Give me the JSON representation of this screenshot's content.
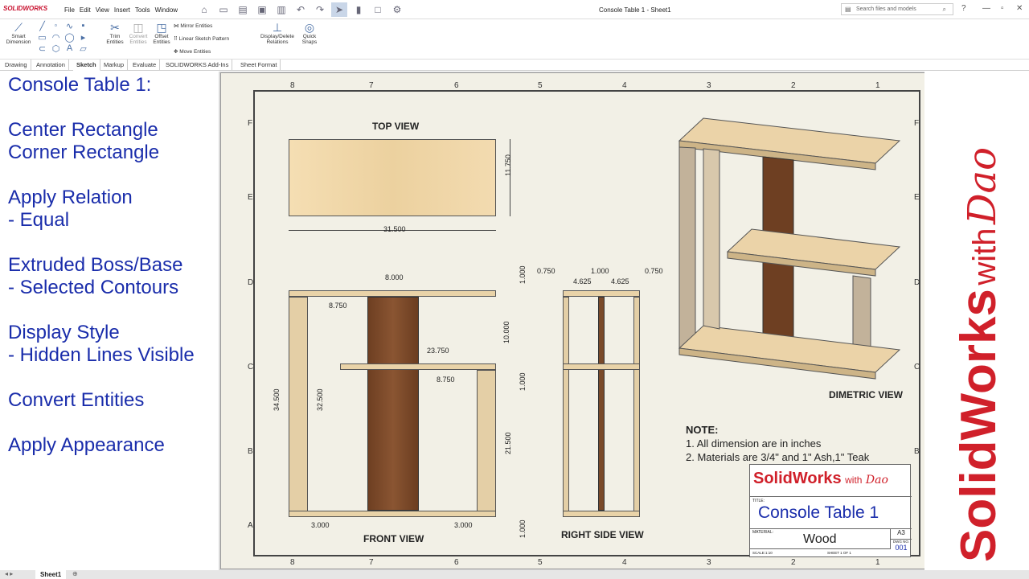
{
  "window": {
    "title": "Console Table 1 - Sheet1",
    "app": "SOLIDWORKS"
  },
  "menu": [
    "File",
    "Edit",
    "View",
    "Insert",
    "Tools",
    "Window"
  ],
  "search": {
    "placeholder": "Search files and models"
  },
  "ribbon": {
    "smart_dimension": "Smart Dimension",
    "trim": "Trim Entities",
    "convert": "Convert Entities",
    "offset": "Offset Entities",
    "mirror": "Mirror Entities",
    "linear_pattern": "Linear Sketch Pattern",
    "move": "Move Entities",
    "display_relations": "Display/Delete Relations",
    "quick_snaps": "Quick Snaps"
  },
  "tabs": [
    "Drawing",
    "Annotation",
    "Sketch",
    "Markup",
    "Evaluate",
    "SOLIDWORKS Add-Ins",
    "Sheet Format"
  ],
  "active_tab": "Sketch",
  "left_panel": {
    "l1": "Console Table 1:",
    "l2": "Center Rectangle",
    "l3": "Corner Rectangle",
    "l4": "Apply Relation",
    "l5": "- Equal",
    "l6": "Extruded Boss/Base",
    "l7": "- Selected Contours",
    "l8": "Display Style",
    "l9": "- Hidden Lines Visible",
    "l10": "Convert Entities",
    "l11": "Apply Appearance"
  },
  "drawing": {
    "zones_cols": [
      "8",
      "7",
      "6",
      "5",
      "4",
      "3",
      "2",
      "1"
    ],
    "zones_rows": [
      "F",
      "E",
      "D",
      "C",
      "B",
      "A"
    ],
    "top_view": "TOP VIEW",
    "front_view": "FRONT VIEW",
    "right_view": "RIGHT SIDE VIEW",
    "dimetric_view": "DIMETRIC VIEW",
    "dims": {
      "d31_5": "31.500",
      "d11_75": "11.750",
      "d8": "8.000",
      "d8_75a": "8.750",
      "d23_75": "23.750",
      "d8_75b": "8.750",
      "d34_5": "34.500",
      "d32_5": "32.500",
      "d10": "10.000",
      "d1a": "1.000",
      "d1b": "1.000",
      "d21_5": "21.500",
      "d1c": "1.000",
      "d3a": "3.000",
      "d3b": "3.000",
      "r075a": "0.750",
      "r1": "1.000",
      "r075b": "0.750",
      "r4625a": "4.625",
      "r4625b": "4.625"
    },
    "note_title": "NOTE:",
    "note_1": "1. All dimension are in inches",
    "note_2": "2. Materials are 3/4\" and 1\" Ash,1\" Teak"
  },
  "title_block": {
    "brand": "SolidWorks",
    "brand_with": "with",
    "signature": "Dao",
    "title_label": "TITLE:",
    "title": "Console Table 1",
    "material_label": "MATERIAL:",
    "material": "Wood",
    "size": "A3",
    "dwg_label": "DWG NO.",
    "dwg_no": "001",
    "scale": "SCALE:1:10",
    "sheet": "SHEET 1 OF 1"
  },
  "brand_vertical": {
    "main": "SolidWorks",
    "with": "with",
    "signature": "Dao"
  },
  "sheet_tab": "Sheet1",
  "colors": {
    "ash": "#e9d3a8",
    "teak": "#7a4a2a",
    "accent": "#1a2dab",
    "brand_red": "#d0202a"
  }
}
